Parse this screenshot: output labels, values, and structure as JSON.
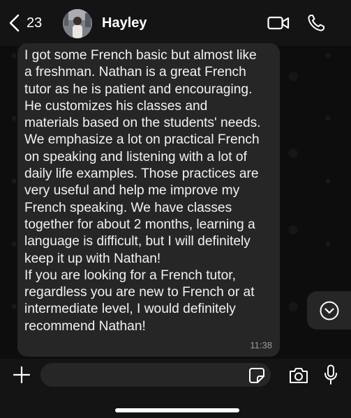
{
  "header": {
    "back_count": "23",
    "contact_name": "Hayley"
  },
  "message": {
    "text": "I got some French basic but almost like\na freshman. Nathan is a great French\ntutor as he is patient and encouraging.\nHe customizes his classes and\nmaterials based on the students' needs.\nWe emphasize a lot on practical French\non speaking and listening with a lot of\ndaily life examples. Those practices are\nvery useful and help me improve my\nFrench speaking. We have classes\ntogether for about 2 months, learning a\nlanguage is difficult, but I will definitely\nkeep it up with Nathan!\nIf you are looking for a French tutor,\nregardless you are new to French or at\nintermediate level, I would definitely\nrecommend Nathan!",
    "time": "11:38"
  },
  "composer": {
    "placeholder": ""
  },
  "icons": {
    "back": "chevron-left-icon",
    "video": "video-camera-icon",
    "phone": "phone-icon",
    "scroll": "chevron-down-circle-icon",
    "plus": "plus-icon",
    "sticker": "sticker-icon",
    "camera": "camera-icon",
    "mic": "microphone-icon"
  },
  "colors": {
    "background": "#0b0b0b",
    "bar": "#141414",
    "bubble": "#262626",
    "text": "#f2f2f2",
    "timestamp": "#9a9a9a"
  }
}
